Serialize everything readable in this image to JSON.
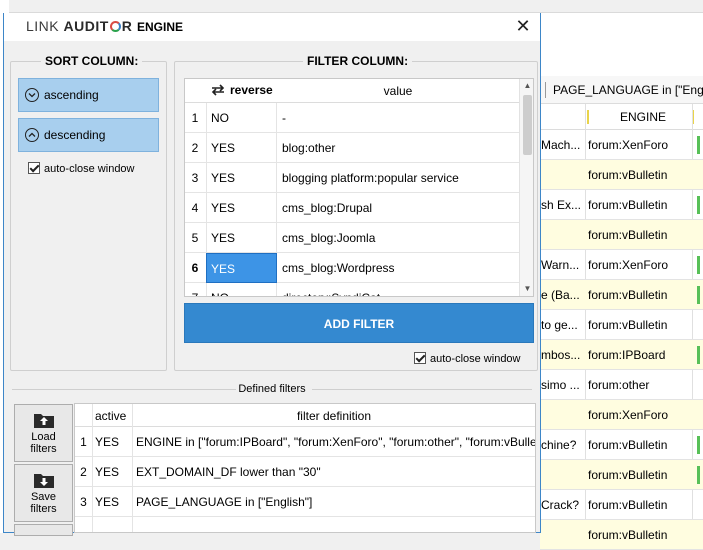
{
  "background": {
    "filter_bar_text": "PAGE_LANGUAGE in [\"English",
    "column_header": "ENGINE",
    "rows": [
      {
        "a": "Mach...",
        "b": "forum:XenForo"
      },
      {
        "a": "",
        "b": "forum:vBulletin"
      },
      {
        "a": "sh Ex...",
        "b": "forum:vBulletin"
      },
      {
        "a": "",
        "b": "forum:vBulletin"
      },
      {
        "a": "Warn...",
        "b": "forum:XenForo"
      },
      {
        "a": "e (Ba...",
        "b": "forum:vBulletin"
      },
      {
        "a": "to ge...",
        "b": "forum:vBulletin"
      },
      {
        "a": "mbos...",
        "b": "forum:IPBoard"
      },
      {
        "a": "simo ...",
        "b": "forum:other"
      },
      {
        "a": "",
        "b": "forum:XenForo"
      },
      {
        "a": "chine?",
        "b": "forum:vBulletin"
      },
      {
        "a": "",
        "b": "forum:vBulletin"
      },
      {
        "a": "Crack?",
        "b": "forum:vBulletin"
      },
      {
        "a": "",
        "b": "forum:vBulletin"
      }
    ]
  },
  "dialog": {
    "logo_left": "LINK ",
    "logo_mid": "AUDIT",
    "logo_right": "R",
    "title": "ENGINE",
    "close": "✕",
    "sort": {
      "heading": "SORT COLUMN:",
      "ascending": "ascending",
      "descending": "descending",
      "autoclose": "auto-close window"
    },
    "filter": {
      "heading": "FILTER COLUMN:",
      "col_reverse": "reverse",
      "col_value": "value",
      "rows": [
        {
          "n": "1",
          "reverse": "NO",
          "value": "-"
        },
        {
          "n": "2",
          "reverse": "YES",
          "value": "blog:other"
        },
        {
          "n": "3",
          "reverse": "YES",
          "value": "blogging platform:popular service"
        },
        {
          "n": "4",
          "reverse": "YES",
          "value": "cms_blog:Drupal"
        },
        {
          "n": "5",
          "reverse": "YES",
          "value": "cms_blog:Joomla"
        },
        {
          "n": "6",
          "reverse": "YES",
          "value": "cms_blog:Wordpress"
        },
        {
          "n": "7",
          "reverse": "NO",
          "value": "directory:SyndiCat"
        }
      ],
      "add_button": "ADD FILTER",
      "autoclose": "auto-close window"
    },
    "defined": {
      "heading": "Defined filters",
      "col_active": "active",
      "col_definition": "filter definition",
      "load_label": "Load filters",
      "save_label": "Save filters",
      "rows": [
        {
          "n": "1",
          "active": "YES",
          "definition": "ENGINE in [\"forum:IPBoard\", \"forum:XenForo\", \"forum:other\", \"forum:vBulletin\"]"
        },
        {
          "n": "2",
          "active": "YES",
          "definition": "EXT_DOMAIN_DF lower than \"30\""
        },
        {
          "n": "3",
          "active": "YES",
          "definition": "PAGE_LANGUAGE in [\"English\"]"
        }
      ]
    }
  }
}
